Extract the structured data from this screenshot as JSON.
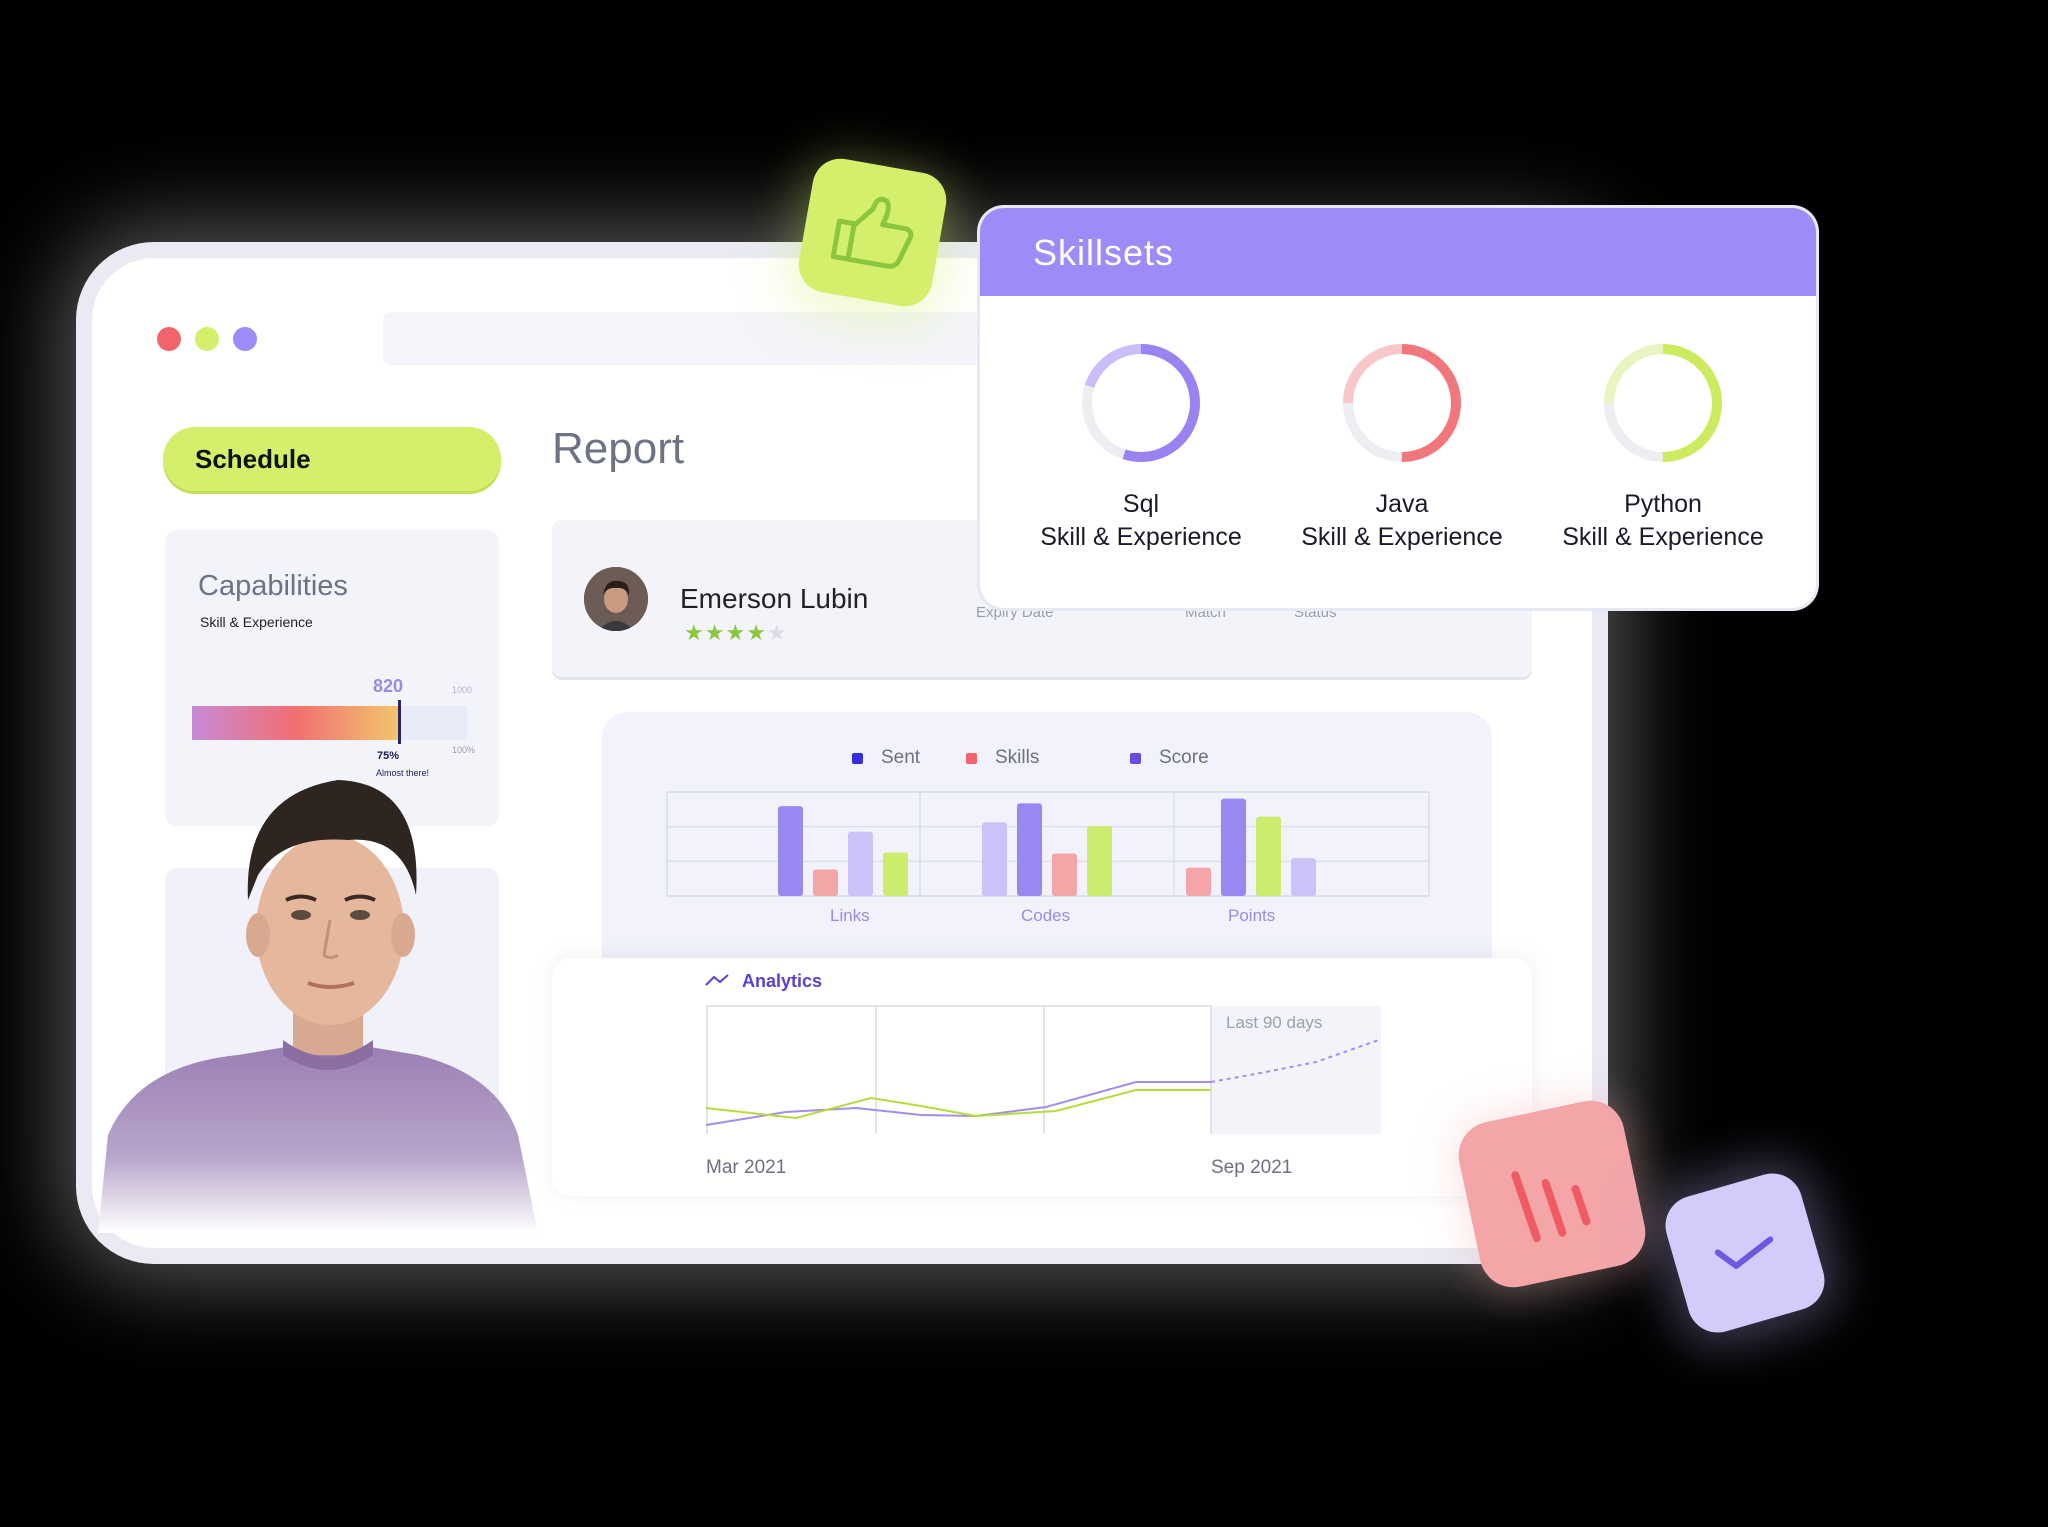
{
  "window": {
    "traffic_lights": [
      "#f2646a",
      "#d4ef6c",
      "#9e8bf7"
    ]
  },
  "sidebar": {
    "schedule_label": "Schedule",
    "capabilities": {
      "title": "Capabilities",
      "subtitle": "Skill & Experience",
      "value": "820",
      "max_label": "1000",
      "full_label": "100%",
      "percent_label": "75%",
      "progress_fraction": 0.75,
      "message": "Almost there!"
    }
  },
  "report": {
    "title": "Report",
    "profile": {
      "name": "Emerson Lubin",
      "rating": 4,
      "rating_max": 5,
      "expiry_label": "Expiry Date",
      "match_label": "Match",
      "status_label": "Status"
    }
  },
  "bar_chart": {
    "chart_data": {
      "type": "bar",
      "categories": [
        "Links",
        "Codes",
        "Points"
      ],
      "series": [
        {
          "name": "Sent",
          "color": "#9889f2",
          "values": [
            95,
            98,
            103
          ]
        },
        {
          "name": "Skills",
          "color": "#f3a5a8",
          "values": [
            28,
            45,
            30
          ]
        },
        {
          "name": "Score",
          "color": "#c9c3f8",
          "values": [
            68,
            78,
            40
          ]
        },
        {
          "name": "",
          "color": "#cbec6e",
          "values": [
            46,
            74,
            84
          ]
        }
      ],
      "legend": [
        {
          "label": "Sent",
          "color": "#3a2de0"
        },
        {
          "label": "Skills",
          "color": "#f2646a"
        },
        {
          "label": "Score",
          "color": "#6a4be0"
        }
      ]
    }
  },
  "analytics": {
    "title": "Analytics",
    "range_label": "Last 90 days",
    "start_date": "Mar 2021",
    "end_date": "Sep 2021"
  },
  "skillsets": {
    "title": "Skillsets",
    "items": [
      {
        "name": "Sql",
        "subtitle": "Skill & Experience",
        "color": "#9a82f0",
        "light": "#cbbef8",
        "fraction": 0.55
      },
      {
        "name": "Java",
        "subtitle": "Skill & Experience",
        "color": "#f2777c",
        "light": "#f8c7c9",
        "fraction": 0.5
      },
      {
        "name": "Python",
        "subtitle": "Skill & Experience",
        "color": "#cdeb5e",
        "light": "#e8f5c0",
        "fraction": 0.5
      }
    ]
  }
}
